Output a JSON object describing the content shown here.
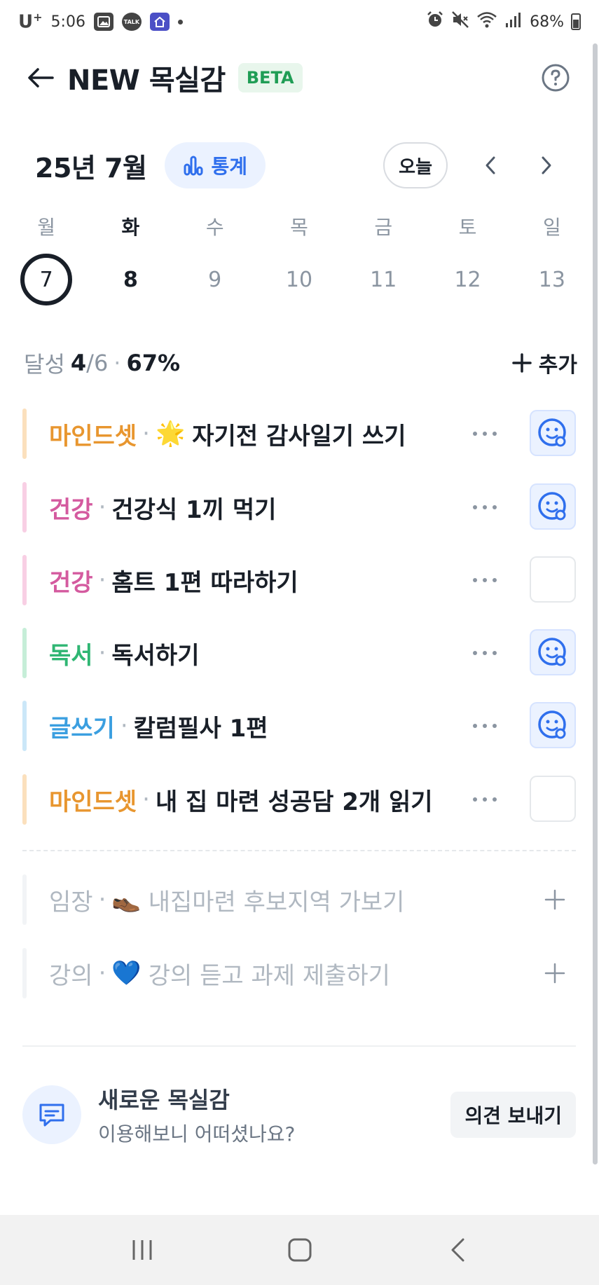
{
  "status_bar": {
    "carrier": "U",
    "carrier_sup": "+",
    "time": "5:06",
    "talk_label": "TALK",
    "battery": "68%"
  },
  "header": {
    "title": "NEW 목실감",
    "badge": "BETA"
  },
  "calendar": {
    "month_label": "25년 7월",
    "stats_label": "통계",
    "today_label": "오늘",
    "days": [
      {
        "name": "월",
        "num": "7"
      },
      {
        "name": "화",
        "num": "8"
      },
      {
        "name": "수",
        "num": "9"
      },
      {
        "name": "목",
        "num": "10"
      },
      {
        "name": "금",
        "num": "11"
      },
      {
        "name": "토",
        "num": "12"
      },
      {
        "name": "일",
        "num": "13"
      }
    ]
  },
  "achievement": {
    "label": "달성",
    "done": "4",
    "total": "/6",
    "dot": "·",
    "percent": "67%",
    "add_label": "추가"
  },
  "tasks": [
    {
      "category": "마인드셋",
      "emoji": "🌟",
      "name": "자기전 감사일기 쓰기",
      "done": true,
      "color": "#e8962f",
      "bar": "#fbe0bd"
    },
    {
      "category": "건강",
      "emoji": "",
      "name": "건강식 1끼 먹기",
      "done": true,
      "color": "#d45a9f",
      "bar": "#f8cfe4"
    },
    {
      "category": "건강",
      "emoji": "",
      "name": "홈트 1편 따라하기",
      "done": false,
      "color": "#d45a9f",
      "bar": "#f8cfe4"
    },
    {
      "category": "독서",
      "emoji": "",
      "name": "독서하기",
      "done": true,
      "color": "#2fb673",
      "bar": "#c6eed8"
    },
    {
      "category": "글쓰기",
      "emoji": "",
      "name": "칼럼필사 1편",
      "done": true,
      "color": "#3b9fe0",
      "bar": "#cbe7f8"
    },
    {
      "category": "마인드셋",
      "emoji": "",
      "name": "내 집 마련 성공담 2개 읽기",
      "done": false,
      "color": "#e8962f",
      "bar": "#fbe0bd"
    }
  ],
  "separator": "·",
  "suggestions": [
    {
      "category": "임장",
      "emoji": "👞",
      "name": "내집마련 후보지역 가보기"
    },
    {
      "category": "강의",
      "emoji": "💙",
      "name": "강의 듣고 과제 제출하기"
    }
  ],
  "feedback": {
    "title": "새로운 목실감",
    "subtitle": "이용해보니 어떠셨나요?",
    "button": "의견 보내기"
  },
  "colors": {
    "accent": "#2f6fed",
    "beta_bg": "#e8f6ec",
    "beta_text": "#1f9d55"
  }
}
